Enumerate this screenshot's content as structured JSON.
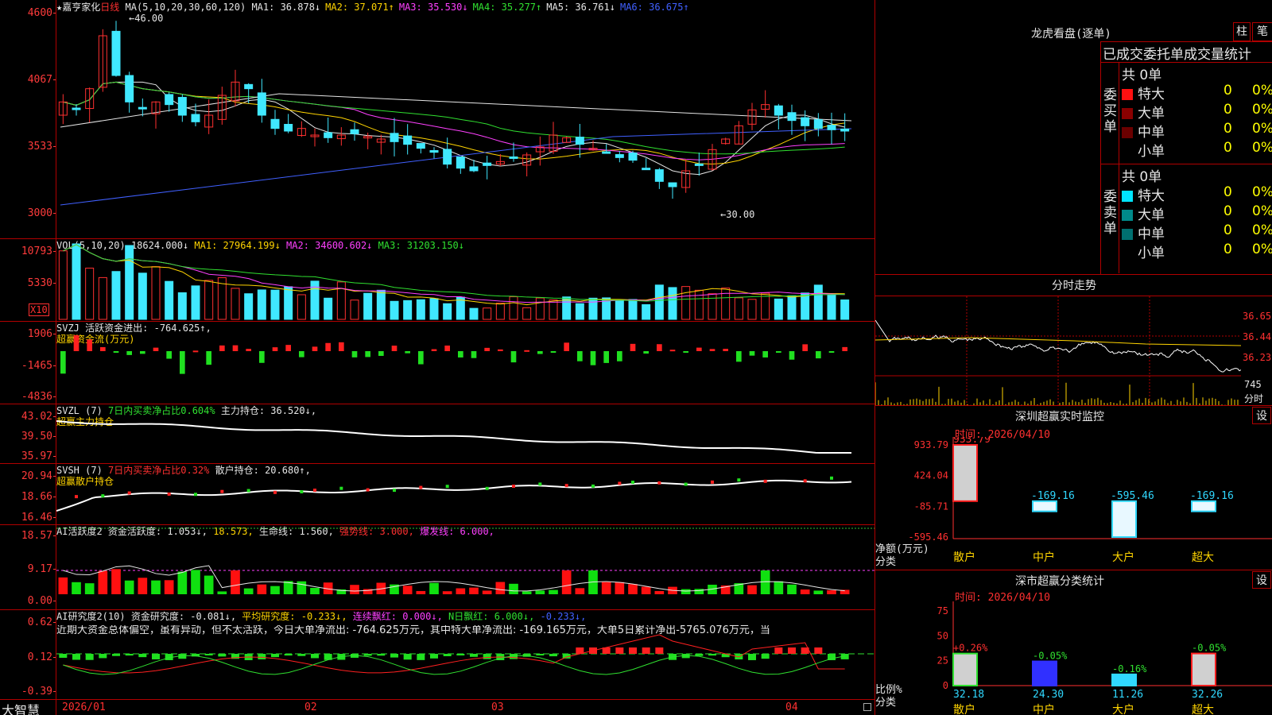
{
  "stock": {
    "name": "嘉亨家化",
    "period": "日线",
    "ma_label": "MA(5,10,20,30,60,120)",
    "ma": [
      {
        "label": "MA1:",
        "value": "36.878",
        "arrow": "↓",
        "color": "#e6e6e6"
      },
      {
        "label": "MA2:",
        "value": "37.071",
        "arrow": "↑",
        "color": "#ffd400"
      },
      {
        "label": "MA3:",
        "value": "35.530",
        "arrow": "↓",
        "color": "#ff40ff"
      },
      {
        "label": "MA4:",
        "value": "35.277",
        "arrow": "↑",
        "color": "#30e030"
      },
      {
        "label": "MA5:",
        "value": "36.761",
        "arrow": "↓",
        "color": "#e6e6e6"
      },
      {
        "label": "MA6:",
        "value": "36.675",
        "arrow": "↑",
        "color": "#4060ff"
      }
    ],
    "high_label": "46.00",
    "low_label": "30.00",
    "y_ticks": [
      "4600",
      "4067",
      "3533",
      "3000"
    ]
  },
  "vol": {
    "label": "VOL(5,10,20)",
    "value": "18624.000↓",
    "ma1": "MA1: 27964.199↓",
    "ma2": "MA2: 34600.602↓",
    "ma3": "MA3: 31203.150↓",
    "y_ticks": [
      "10793",
      "5330"
    ],
    "unit": "X10"
  },
  "svzj": {
    "label": "SVZJ",
    "text": "活跃资金进出: -764.625↑,",
    "sub": "超赢资金流(万元)",
    "y_ticks": [
      "1906",
      "-1465",
      "-4836"
    ]
  },
  "svzl": {
    "label": "SVZL (7)",
    "t1": "7日内买卖净占比0.604%",
    "t2": "主力持仓: 36.520↓,",
    "sub": "超赢主力持仓",
    "y_ticks": [
      "43.02",
      "39.50",
      "35.97"
    ]
  },
  "svsh": {
    "label": "SVSH (7)",
    "t1": "7日内买卖净占比0.32%",
    "t2": "散户持仓: 20.680↑,",
    "sub": "超赢散户持仓",
    "y_ticks": [
      "20.94",
      "18.66",
      "16.46"
    ]
  },
  "ai1": {
    "label": "AI活跃度2",
    "t1": "资金活跃度: 1.053↓,",
    "t2": "18.573,",
    "t3": "生命线: 1.560,",
    "t4": "强势线: 3.000,",
    "t5": "爆发线: 6.000,",
    "y_ticks": [
      "18.57",
      "9.17",
      "0.00"
    ]
  },
  "ai2": {
    "label": "AI研究度2(10)",
    "t1": "资金研究度: -0.081↓,",
    "t2": "平均研究度: -0.233↓,",
    "t3": "连续飘红: 0.000↓,",
    "t4": "N日飘红: 6.000↓,",
    "t5": "-0.233↓,",
    "comment": "近期大资金总体偏空，虽有异动，但不太活跃，今日大单净流出: -764.625万元，其中特大单净流出: -169.165万元，大单5日累计净出-5765.076万元，当",
    "y_ticks": [
      "0.62",
      "0.12",
      "-0.39"
    ]
  },
  "xaxis": {
    "labels": [
      "2026/01",
      "02",
      "03",
      "04"
    ]
  },
  "brand": "大智慧",
  "lhb": {
    "title": "龙虎看盘(逐单)",
    "btn1": "柱",
    "btn2": "笔",
    "tabs": "已成交委托单成交量统计",
    "buy": {
      "side": "委买单",
      "total": "共 0单",
      "rows": [
        {
          "name": "特大",
          "v": "0",
          "p": "0%"
        },
        {
          "name": "大单",
          "v": "0",
          "p": "0%"
        },
        {
          "name": "中单",
          "v": "0",
          "p": "0%"
        },
        {
          "name": "小单",
          "v": "0",
          "p": "0%"
        }
      ]
    },
    "sell": {
      "side": "委卖单",
      "total": "共 0单",
      "rows": [
        {
          "name": "特大",
          "v": "0",
          "p": "0%"
        },
        {
          "name": "大单",
          "v": "0",
          "p": "0%"
        },
        {
          "name": "中单",
          "v": "0",
          "p": "0%"
        },
        {
          "name": "小单",
          "v": "0",
          "p": "0%"
        }
      ]
    }
  },
  "fenshi": {
    "title": "分时走势",
    "ticks": [
      "36.65",
      "36.44",
      "36.23"
    ],
    "vol1": "745",
    "vol2": "分时"
  },
  "monitor": {
    "title": "深圳超赢实时监控",
    "btn": "设",
    "time": "时间: 2026/04/10",
    "ylabel": "净额(万元)",
    "ylabel2": "分类",
    "y_ticks": [
      "933.79",
      "424.04",
      "-85.71",
      "-595.46"
    ],
    "bars": [
      {
        "cat": "散户",
        "val": 933.79,
        "label": "933.79"
      },
      {
        "cat": "中户",
        "val": -169.16,
        "label": "-169.16"
      },
      {
        "cat": "大户",
        "val": -595.46,
        "label": "-595.46"
      },
      {
        "cat": "超大",
        "val": -169.16,
        "label": "-169.16"
      }
    ]
  },
  "classify": {
    "title": "深市超赢分类统计",
    "btn": "设",
    "time": "时间: 2026/04/10",
    "ylabel": "比例%",
    "ylabel2": "分类",
    "y_ticks": [
      "75",
      "50",
      "25",
      "0"
    ],
    "bars": [
      {
        "cat": "散户",
        "pct": "+0.26%",
        "val": 32.18,
        "label": "32.18"
      },
      {
        "cat": "中户",
        "pct": "-0.05%",
        "val": 24.3,
        "label": "24.30"
      },
      {
        "cat": "大户",
        "pct": "-0.16%",
        "val": 11.26,
        "label": "11.26"
      },
      {
        "cat": "超大",
        "pct": "-0.05%",
        "val": 32.26,
        "label": "32.26"
      }
    ]
  },
  "colors": {
    "up": "#ff3030",
    "down": "#40e8ff",
    "grid": "#b00000"
  }
}
